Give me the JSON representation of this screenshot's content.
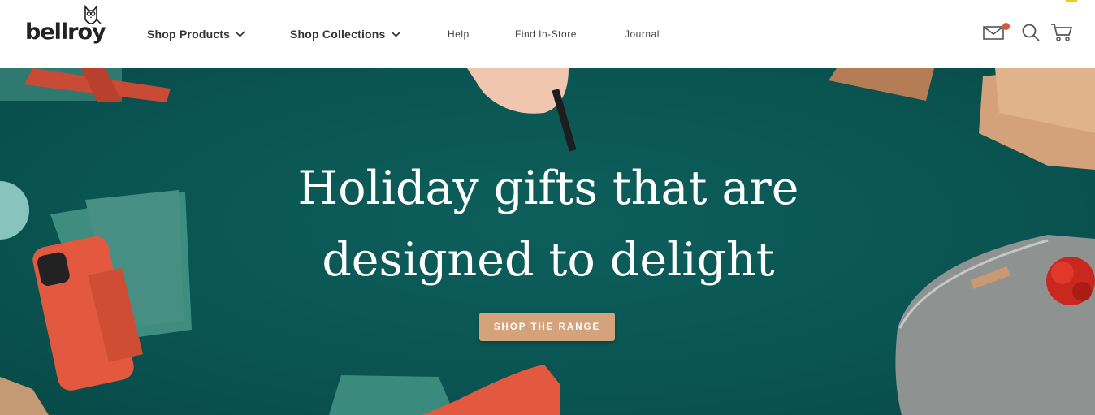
{
  "brand": {
    "logo_text": "bellroy"
  },
  "nav": {
    "items": [
      {
        "label": "Shop Products",
        "has_dropdown": true
      },
      {
        "label": "Shop Collections",
        "has_dropdown": true
      },
      {
        "label": "Help",
        "has_dropdown": false
      },
      {
        "label": "Find In-Store",
        "has_dropdown": false
      },
      {
        "label": "Journal",
        "has_dropdown": false
      }
    ]
  },
  "utility": {
    "icons": [
      "mail-icon",
      "search-icon",
      "cart-icon"
    ],
    "notification_color": "#d8553c"
  },
  "hero": {
    "headline_line1": "Holiday gifts that are",
    "headline_line2": "designed to delight",
    "cta_label": "SHOP THE RANGE",
    "background_color": "#0a5552",
    "cta_color": "#d4a37c"
  }
}
